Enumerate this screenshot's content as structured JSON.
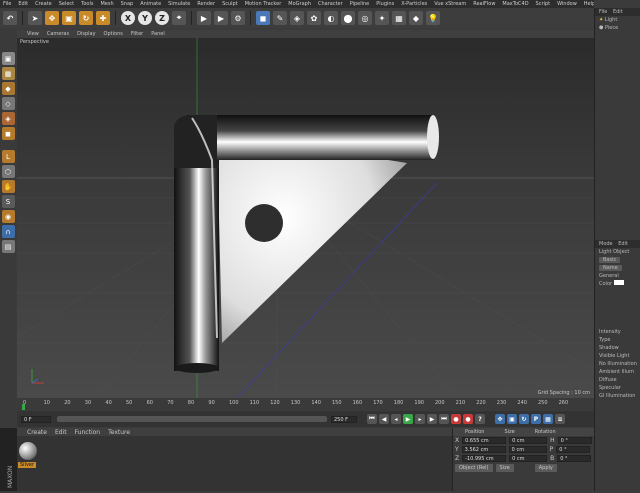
{
  "menu": [
    "File",
    "Edit",
    "Create",
    "Select",
    "Tools",
    "Mesh",
    "Snap",
    "Animate",
    "Simulate",
    "Render",
    "Sculpt",
    "Motion Tracker",
    "MoGraph",
    "Character",
    "Pipeline",
    "Plugins",
    "X-Particles",
    "Vue xStream",
    "RealFlow",
    "MaxToC4D",
    "Script",
    "Window",
    "Help"
  ],
  "toolbar": {
    "x": "X",
    "y": "Y",
    "z": "Z"
  },
  "viewport_menu": [
    "View",
    "Cameras",
    "Display",
    "Options",
    "Filter",
    "Panel"
  ],
  "viewport_label": "Perspective",
  "grid_spacing": "Grid Spacing : 10 cm",
  "timeline_ticks": [
    "0",
    "10",
    "20",
    "30",
    "40",
    "50",
    "60",
    "70",
    "80",
    "90",
    "100",
    "110",
    "120",
    "130",
    "140",
    "150",
    "160",
    "170",
    "180",
    "190",
    "200",
    "210",
    "220",
    "230",
    "240",
    "250",
    "260"
  ],
  "frame_start": "0 F",
  "frame_current": "0 F",
  "frame_end": "250 F",
  "frame_right": "0 F",
  "material_menu": [
    "Create",
    "Edit",
    "Function",
    "Texture"
  ],
  "material_name": "Silver",
  "objects_panel": {
    "tabs": [
      "File",
      "Edit"
    ],
    "items": [
      "Light",
      "Piece"
    ]
  },
  "attr_panel": {
    "tabs": [
      "Mode",
      "Edit"
    ],
    "object": "Light Object",
    "buttons": [
      "Basic",
      "Name"
    ],
    "section": "General",
    "color_label": "Color",
    "props": [
      "Intensity",
      "Type",
      "Shadow",
      "Visible Light",
      "No Illumination",
      "Ambient Illum",
      "Diffuse",
      "Specular",
      "GI Illumination"
    ]
  },
  "coords": {
    "headers": [
      "Position",
      "Size",
      "Rotation"
    ],
    "rows": [
      {
        "axis": "X",
        "pos": "0.655 cm",
        "size": "0 cm",
        "rot_axis": "H",
        "rot": "0 °"
      },
      {
        "axis": "Y",
        "pos": "3.562 cm",
        "size": "0 cm",
        "rot_axis": "P",
        "rot": "0 °"
      },
      {
        "axis": "Z",
        "pos": "-10.995 cm",
        "size": "0 cm",
        "rot_axis": "B",
        "rot": "0 °"
      }
    ],
    "mode": "Object (Rel)",
    "size_mode": "Size",
    "apply": "Apply"
  },
  "logo": "MAXON CINEMA 4D",
  "colors": {
    "accent": "#4a78b8",
    "play": "#3aa64a",
    "record": "#c83a3a"
  }
}
